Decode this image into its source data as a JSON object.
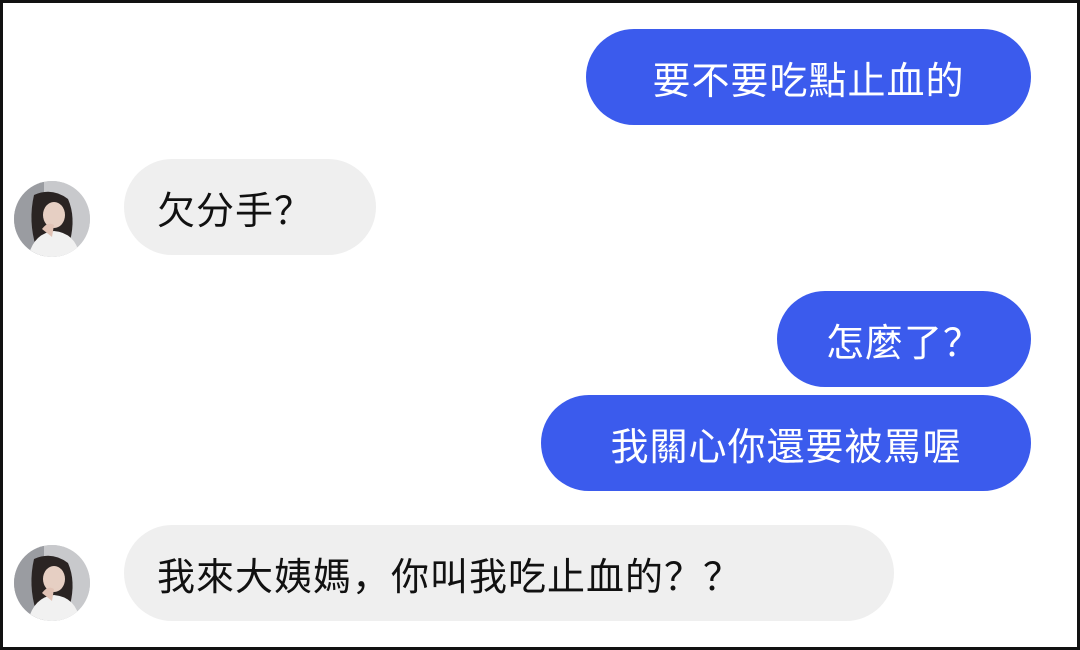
{
  "chat": {
    "colors": {
      "sent_bubble": "#3b5bed",
      "received_bubble": "#efefef"
    },
    "messages": [
      {
        "side": "sent",
        "text": "要不要吃點止血的"
      },
      {
        "side": "received",
        "text": "欠分手？"
      },
      {
        "side": "sent",
        "text": "怎麼了？"
      },
      {
        "side": "sent",
        "text": "我關心你還要被罵喔"
      },
      {
        "side": "received",
        "text": "我來大姨媽，你叫我吃止血的？？"
      }
    ],
    "avatar_icon": "contact-avatar-photo"
  }
}
